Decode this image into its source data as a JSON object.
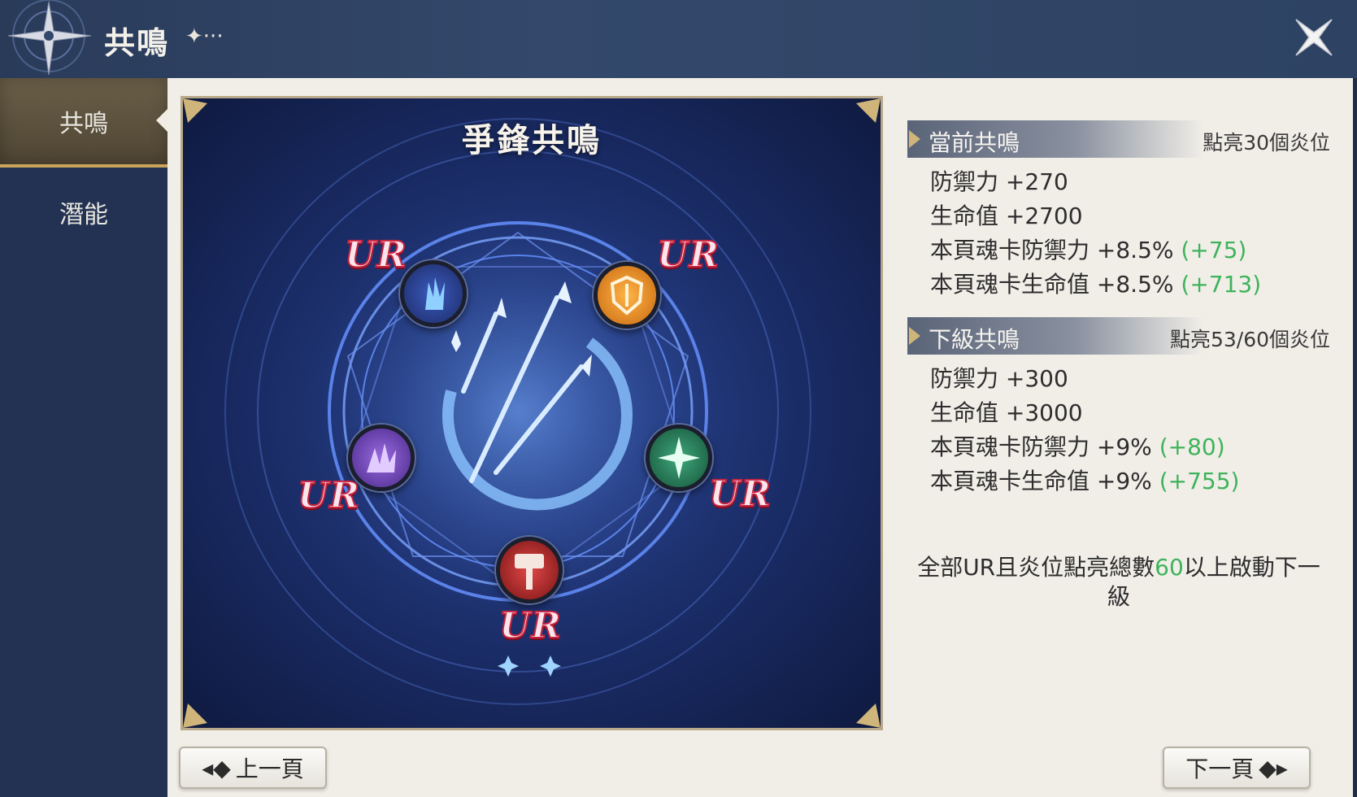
{
  "header": {
    "title": "共鳴",
    "dots": "✦···"
  },
  "sidebar": {
    "tabs": [
      {
        "label": "共鳴",
        "active": true
      },
      {
        "label": "潛能",
        "active": false
      }
    ]
  },
  "resonance": {
    "title": "爭鋒共鳴",
    "sockets": [
      {
        "rarity": "UR",
        "icon": "blue-claw-icon"
      },
      {
        "rarity": "UR",
        "icon": "orange-shield-icon"
      },
      {
        "rarity": "UR",
        "icon": "purple-flame-icon"
      },
      {
        "rarity": "UR",
        "icon": "green-star-icon"
      },
      {
        "rarity": "UR",
        "icon": "red-hammer-icon"
      }
    ]
  },
  "current": {
    "title": "當前共鳴",
    "note": "點亮30個炎位",
    "stats": [
      {
        "text": "防禦力 +270",
        "bonus": ""
      },
      {
        "text": "生命值 +2700",
        "bonus": ""
      },
      {
        "text": "本頁魂卡防禦力 +8.5% ",
        "bonus": "(+75)"
      },
      {
        "text": "本頁魂卡生命值 +8.5% ",
        "bonus": "(+713)"
      }
    ]
  },
  "next": {
    "title": "下級共鳴",
    "note": "點亮53/60個炎位",
    "stats": [
      {
        "text": "防禦力 +300",
        "bonus": ""
      },
      {
        "text": "生命值 +3000",
        "bonus": ""
      },
      {
        "text": "本頁魂卡防禦力 +9% ",
        "bonus": "(+80)"
      },
      {
        "text": "本頁魂卡生命值 +9% ",
        "bonus": "(+755)"
      }
    ]
  },
  "requirement": {
    "pre": "全部UR且炎位點亮總數",
    "num": "60",
    "post": "以上啟動下一級"
  },
  "nav": {
    "prev": "上一頁",
    "next": "下一頁"
  },
  "colors": {
    "accent_green": "#3eb35b",
    "ur_red": "#c8233f",
    "frame_gold": "#cfb57a"
  }
}
